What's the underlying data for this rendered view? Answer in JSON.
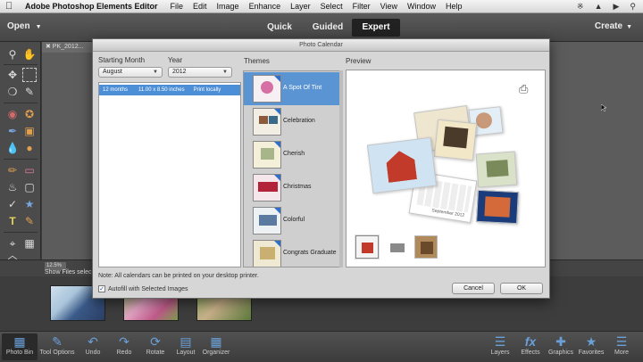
{
  "menubar": {
    "app_name": "Adobe Photoshop Elements Editor",
    "items": [
      "File",
      "Edit",
      "Image",
      "Enhance",
      "Layer",
      "Select",
      "Filter",
      "View",
      "Window",
      "Help"
    ]
  },
  "topbar": {
    "open_label": "Open",
    "modes": [
      "Quick",
      "Guided",
      "Expert"
    ],
    "active_mode": "Expert",
    "create_label": "Create"
  },
  "document": {
    "tab_label": "✖ PK_2012..."
  },
  "bin": {
    "zoom": "12.5%",
    "show_files": "Show Files selec"
  },
  "taskbar": {
    "left": [
      {
        "label": "Photo Bin",
        "icon": "photo-bin-icon"
      },
      {
        "label": "Tool Options",
        "icon": "tool-options-icon"
      },
      {
        "label": "Undo",
        "icon": "undo-icon"
      },
      {
        "label": "Redo",
        "icon": "redo-icon"
      },
      {
        "label": "Rotate",
        "icon": "rotate-icon"
      },
      {
        "label": "Layout",
        "icon": "layout-icon"
      },
      {
        "label": "Organizer",
        "icon": "organizer-icon"
      }
    ],
    "right": [
      {
        "label": "Layers",
        "icon": "layers-icon"
      },
      {
        "label": "Effects",
        "icon": "effects-icon"
      },
      {
        "label": "Graphics",
        "icon": "graphics-icon"
      },
      {
        "label": "Favorites",
        "icon": "favorites-icon"
      },
      {
        "label": "More",
        "icon": "more-icon"
      }
    ]
  },
  "dialog": {
    "title": "Photo Calendar",
    "starting_month_label": "Starting Month",
    "year_label": "Year",
    "month_value": "August",
    "year_value": "2012",
    "themes_label": "Themes",
    "preview_label": "Preview",
    "size_row": {
      "months": "12 months",
      "size": "11.00 x 8.50 inches",
      "print": "Print locally"
    },
    "themes": [
      "A Spot Of Tint",
      "Celebration",
      "Cherish",
      "Christmas",
      "Colorful",
      "Congrats Graduate"
    ],
    "selected_theme": "A Spot Of Tint",
    "calendar_caption": "September 2012",
    "note": "Note: All calendars can be printed on your desktop printer.",
    "autofill_label": "Autofill with Selected Images",
    "autofill_checked": true,
    "cancel_label": "Cancel",
    "ok_label": "OK"
  },
  "colors": {
    "selection_blue": "#4d8fd6",
    "theme_selected": "#5a94d3",
    "corner_triangle": "#2f6fc8"
  }
}
